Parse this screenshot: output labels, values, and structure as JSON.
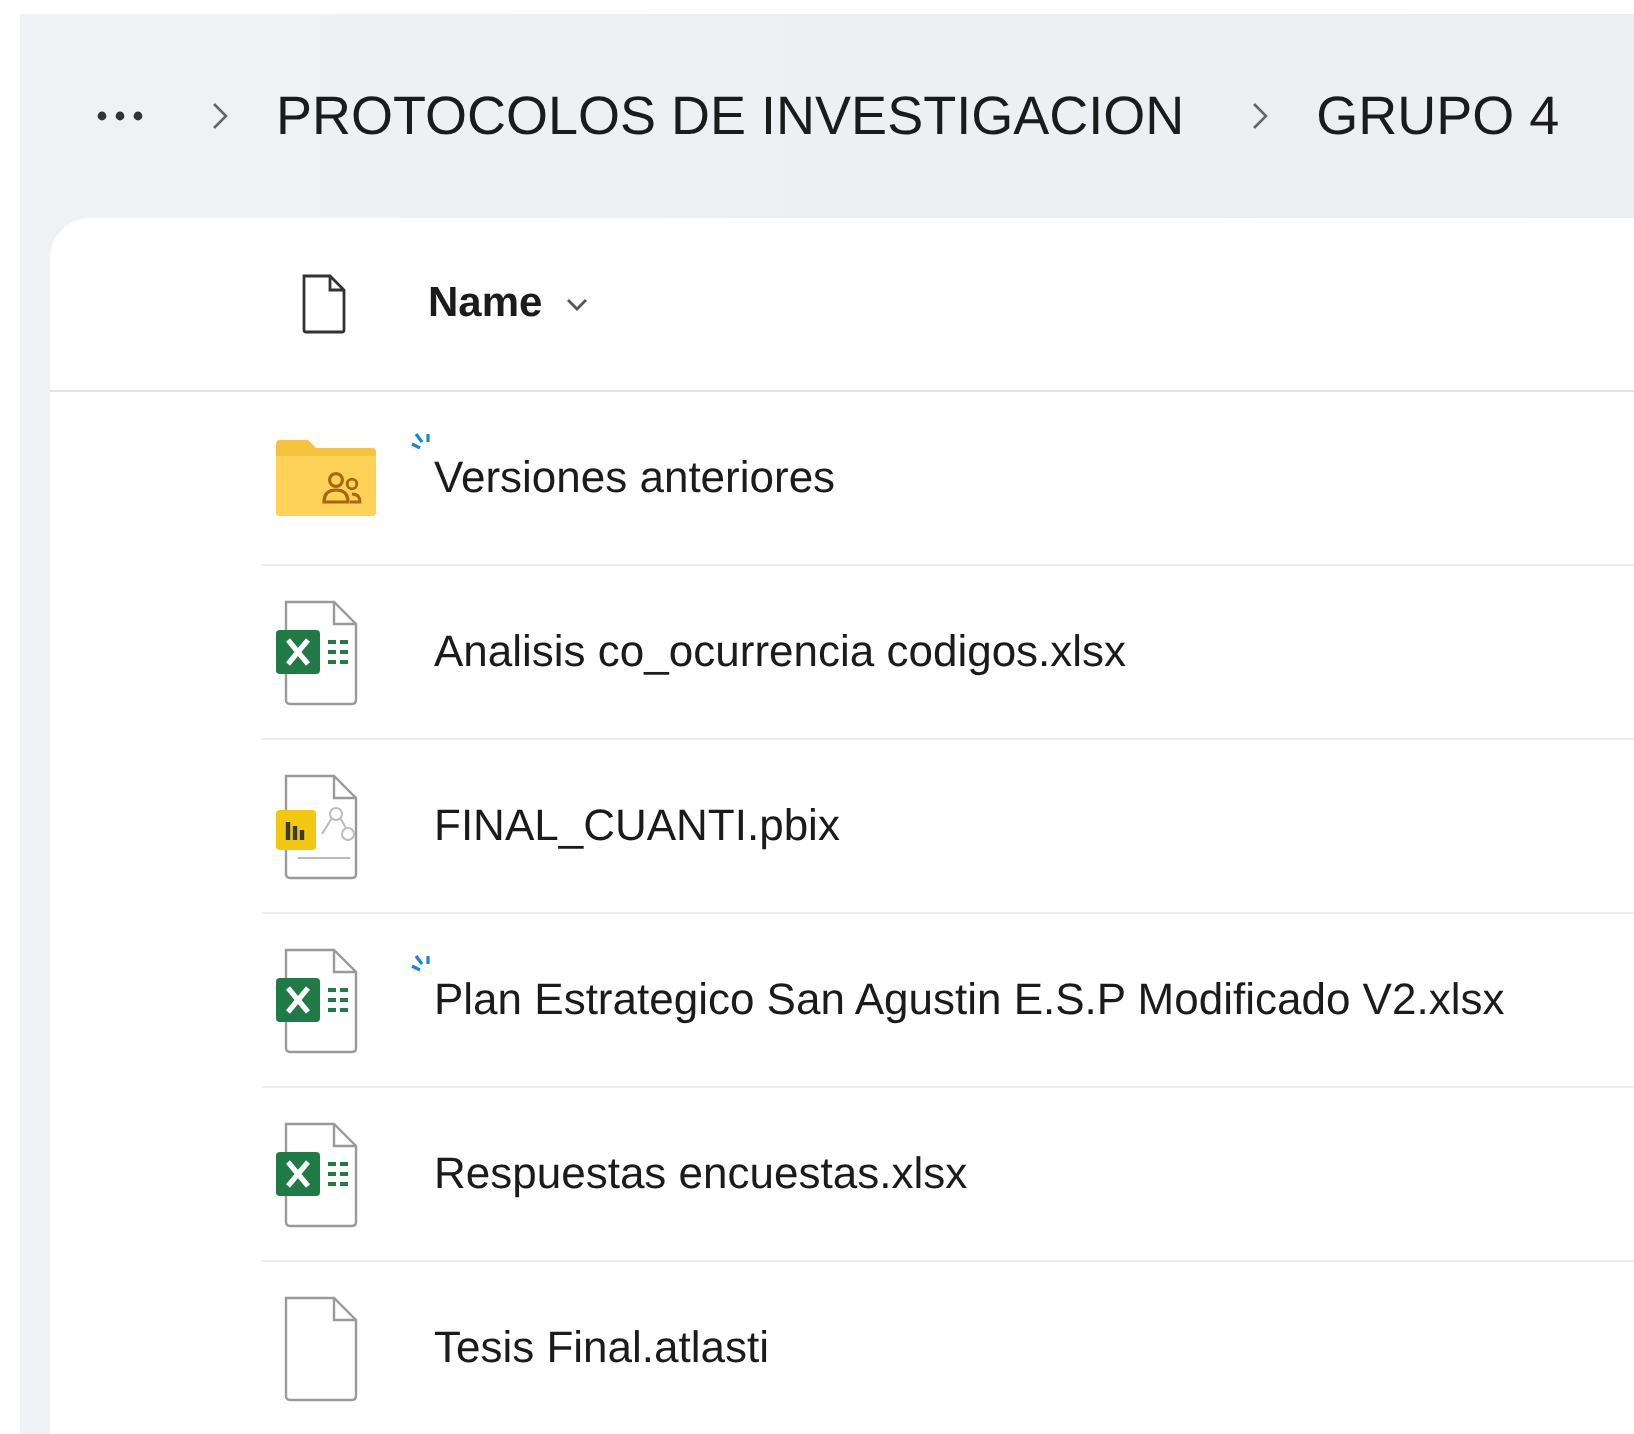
{
  "breadcrumb": [
    {
      "label": "PROTOCOLOS DE INVESTIGACION"
    },
    {
      "label": "GRUPO 4"
    }
  ],
  "columns": [
    {
      "label": "Name",
      "sorted": true
    }
  ],
  "files": [
    {
      "name": "Versiones anteriores",
      "kind": "shared-folder",
      "new": true
    },
    {
      "name": "Analisis co_ocurrencia codigos.xlsx",
      "kind": "excel",
      "new": false
    },
    {
      "name": "FINAL_CUANTI.pbix",
      "kind": "powerbi",
      "new": false
    },
    {
      "name": "Plan Estrategico San Agustin E.S.P Modificado V2.xlsx",
      "kind": "excel",
      "new": true
    },
    {
      "name": "Respuestas encuestas.xlsx",
      "kind": "excel",
      "new": false
    },
    {
      "name": "Tesis Final.atlasti",
      "kind": "generic",
      "new": false
    }
  ]
}
